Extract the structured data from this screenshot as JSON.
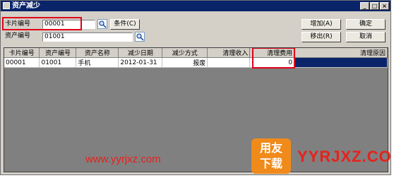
{
  "window": {
    "title": "资产减少",
    "controls": {
      "minimize": "_",
      "maximize": "□",
      "close": "×"
    }
  },
  "form": {
    "card_no_label": "卡片编号",
    "card_no_value": "00001",
    "asset_no_label": "资产编号",
    "asset_no_value": "01001",
    "condition_button": "条件(C)"
  },
  "actions": {
    "add": "增加(A)",
    "confirm": "确定",
    "remove": "移出(R)",
    "cancel": "取消"
  },
  "table": {
    "headers": [
      "卡片编号",
      "资产编号",
      "资产名称",
      "减少日期",
      "减少方式",
      "清理收入",
      "清理费用",
      "清理原因"
    ],
    "rows": [
      [
        "00001",
        "01001",
        "手机",
        "2012-01-31",
        "报废",
        "",
        "0",
        ""
      ]
    ]
  },
  "watermark": {
    "url": "www.yyrjxz.com",
    "logo": "用友\n下载",
    "brand": "YYRJXZ.COM"
  }
}
